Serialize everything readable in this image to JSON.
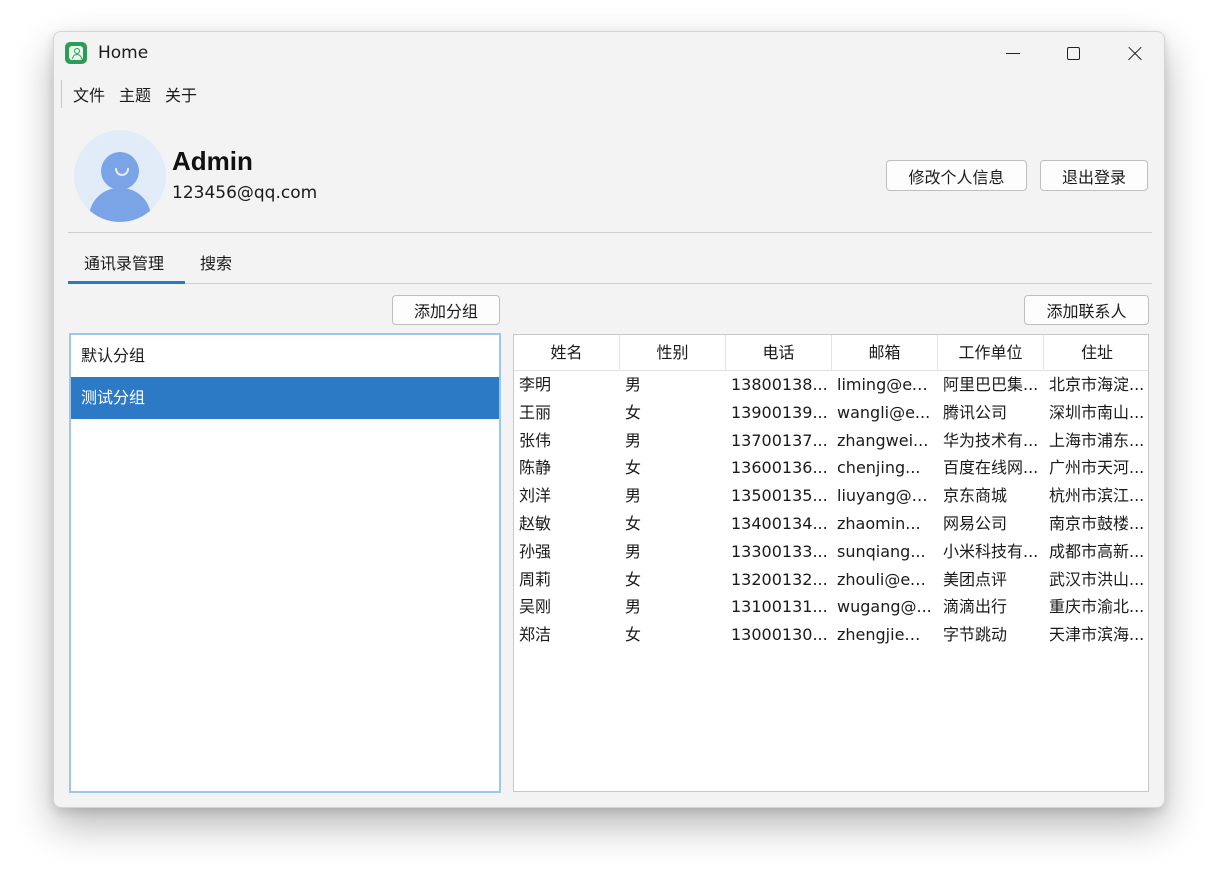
{
  "window": {
    "title": "Home"
  },
  "menu": [
    "文件",
    "主题",
    "关于"
  ],
  "profile": {
    "name": "Admin",
    "email": "123456@qq.com",
    "edit_label": "修改个人信息",
    "logout_label": "退出登录"
  },
  "tabs": [
    {
      "label": "通讯录管理",
      "active": true
    },
    {
      "label": "搜索",
      "active": false
    }
  ],
  "groups": {
    "add_label": "添加分组",
    "items": [
      {
        "label": "默认分组",
        "selected": false
      },
      {
        "label": "测试分组",
        "selected": true
      }
    ]
  },
  "contacts": {
    "add_label": "添加联系人",
    "columns": [
      "姓名",
      "性别",
      "电话",
      "邮箱",
      "工作单位",
      "住址"
    ],
    "rows": [
      [
        "李明",
        "男",
        "13800138...",
        "liming@ex...",
        "阿里巴巴集...",
        "北京市海淀..."
      ],
      [
        "王丽",
        "女",
        "13900139...",
        "wangli@e...",
        "腾讯公司",
        "深圳市南山..."
      ],
      [
        "张伟",
        "男",
        "13700137...",
        "zhangwei...",
        "华为技术有...",
        "上海市浦东..."
      ],
      [
        "陈静",
        "女",
        "13600136...",
        "chenjing...",
        "百度在线网...",
        "广州市天河..."
      ],
      [
        "刘洋",
        "男",
        "13500135...",
        "liuyang@e...",
        "京东商城",
        "杭州市滨江..."
      ],
      [
        "赵敏",
        "女",
        "13400134...",
        "zhaomin...",
        "网易公司",
        "南京市鼓楼..."
      ],
      [
        "孙强",
        "男",
        "13300133...",
        "sunqiang...",
        "小米科技有...",
        "成都市高新..."
      ],
      [
        "周莉",
        "女",
        "13200132...",
        "zhouli@ex...",
        "美团点评",
        "武汉市洪山..."
      ],
      [
        "吴刚",
        "男",
        "13100131...",
        "wugang@...",
        "滴滴出行",
        "重庆市渝北..."
      ],
      [
        "郑洁",
        "女",
        "13000130...",
        "zhengjie@...",
        "字节跳动",
        "天津市滨海..."
      ]
    ]
  },
  "colors": {
    "accent": "#2c79c6",
    "app_icon": "#2e9b58",
    "avatar": "#7ba4e6"
  },
  "icons": {
    "app": "contacts-app-icon",
    "minimize": "minimize-icon",
    "maximize": "maximize-icon",
    "close": "close-icon",
    "avatar": "user-avatar-icon"
  }
}
